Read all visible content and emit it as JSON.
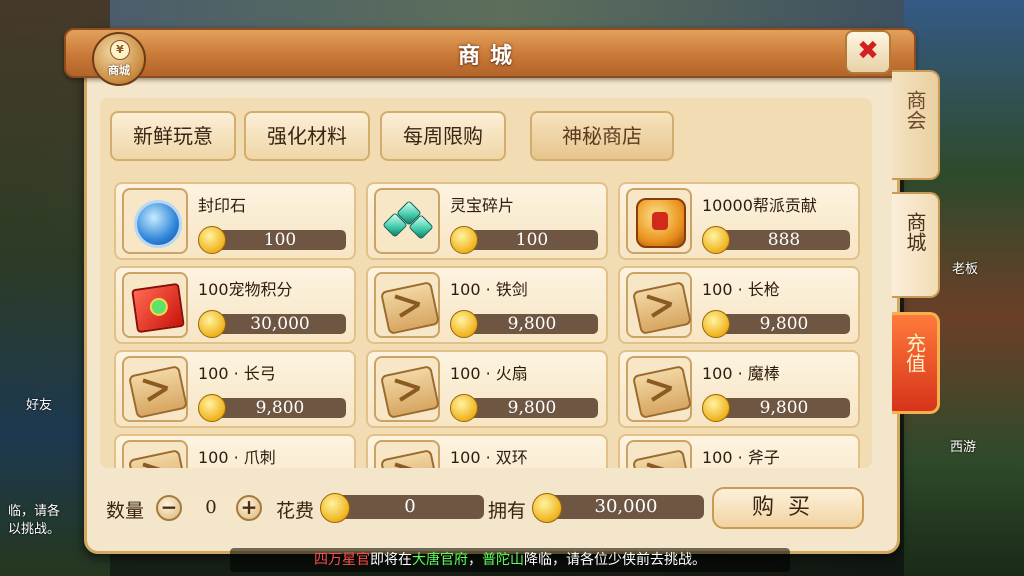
{
  "window": {
    "title": "商城",
    "badge_label": "商城",
    "badge_symbol": "¥"
  },
  "tabs": [
    {
      "label": "新鲜玩意"
    },
    {
      "label": "强化材料"
    },
    {
      "label": "每周限购"
    },
    {
      "label": "神秘商店"
    }
  ],
  "side_tabs": [
    {
      "label": "商会"
    },
    {
      "label": "商城"
    },
    {
      "label": "充值"
    }
  ],
  "items": [
    {
      "name": "封印石",
      "price": "100",
      "icon": "seal-stone-icon"
    },
    {
      "name": "灵宝碎片",
      "price": "100",
      "icon": "spirit-shard-icon"
    },
    {
      "name": "10000帮派贡献",
      "price": "888",
      "icon": "guild-contribution-icon"
    },
    {
      "name": "100宠物积分",
      "price": "30,000",
      "icon": "pet-points-icon"
    },
    {
      "name": "100 · 铁剑",
      "price": "9,800",
      "icon": "scroll-icon"
    },
    {
      "name": "100 · 长枪",
      "price": "9,800",
      "icon": "scroll-icon"
    },
    {
      "name": "100 · 长弓",
      "price": "9,800",
      "icon": "scroll-icon"
    },
    {
      "name": "100 · 火扇",
      "price": "9,800",
      "icon": "scroll-icon"
    },
    {
      "name": "100 · 魔棒",
      "price": "9,800",
      "icon": "scroll-icon"
    },
    {
      "name": "100 · 爪刺",
      "price": "",
      "icon": "scroll-icon"
    },
    {
      "name": "100 · 双环",
      "price": "",
      "icon": "scroll-icon"
    },
    {
      "name": "100 · 斧子",
      "price": "",
      "icon": "scroll-icon"
    }
  ],
  "purchase": {
    "quantity_label": "数量",
    "quantity": "0",
    "minus": "−",
    "plus": "+",
    "cost_label": "花费",
    "cost": "0",
    "own_label": "拥有",
    "own": "30,000",
    "buy_label": "购买"
  },
  "background": {
    "left_text_1": "好友",
    "left_text_2": "临，请各",
    "left_text_3": "以挑战。",
    "right_text_1": "西游",
    "right_text_2": "老板"
  },
  "ticker": {
    "part1": "四万星官",
    "part2": "即将在",
    "part3": "大唐官府",
    "part4": "，",
    "part5": "普陀山",
    "part6": "降临，请各位少侠前去挑战。"
  },
  "colors": {
    "accent": "#c77634",
    "price_bar": "#6e5642",
    "panel": "#f4e6cb",
    "recharge": "#d7331a"
  }
}
